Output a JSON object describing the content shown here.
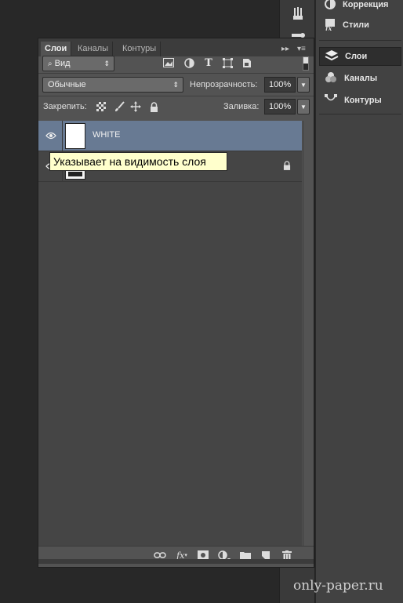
{
  "dock": {
    "panels": [
      {
        "label": "Коррекция",
        "icon": "adjustments-icon"
      },
      {
        "label": "Стили",
        "icon": "fx-styles-icon"
      },
      {
        "label": "Слои",
        "icon": "layers-icon",
        "active": true
      },
      {
        "label": "Каналы",
        "icon": "channels-icon"
      },
      {
        "label": "Контуры",
        "icon": "paths-icon"
      }
    ]
  },
  "panel": {
    "tabs": [
      "Слои",
      "Каналы",
      "Контуры"
    ],
    "filter": {
      "value": "Вид"
    },
    "blend_mode": "Обычные",
    "opacity_label": "Непрозрачность:",
    "opacity_value": "100%",
    "lock_label": "Закрепить:",
    "fill_label": "Заливка:",
    "fill_value": "100%",
    "layers": [
      {
        "name": "WHITE",
        "selected": true,
        "visible": true
      },
      {
        "name": "",
        "selected": false,
        "visible": true,
        "locked": true
      }
    ],
    "tooltip": "Указывает на видимость слоя",
    "bottom_icons": [
      "link-icon",
      "fx-icon",
      "mask-icon",
      "adjustment-icon",
      "folder-icon",
      "new-layer-icon",
      "trash-icon"
    ]
  },
  "watermark": "only-paper.ru",
  "colors": {
    "selected_layer": "#687a93",
    "tooltip_bg": "#ffffcc"
  }
}
